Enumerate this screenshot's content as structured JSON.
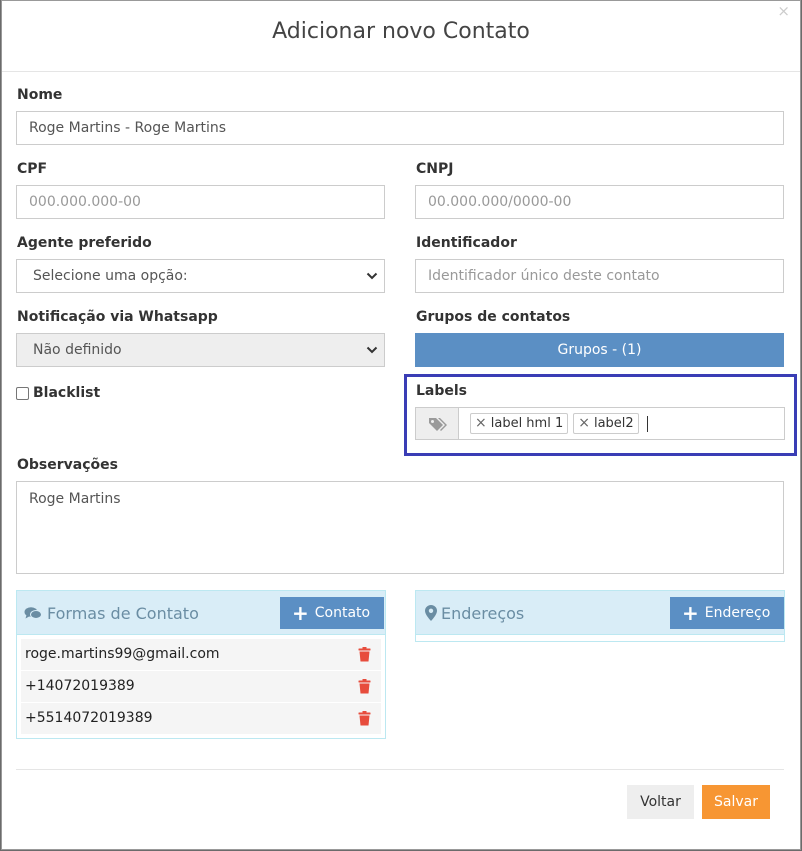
{
  "modal": {
    "title": "Adicionar novo Contato",
    "close_glyph": "×"
  },
  "fields": {
    "nome": {
      "label": "Nome",
      "value": "Roge Martins - Roge Martins"
    },
    "cpf": {
      "label": "CPF",
      "placeholder": "000.000.000-00"
    },
    "cnpj": {
      "label": "CNPJ",
      "placeholder": "00.000.000/0000-00"
    },
    "agente": {
      "label": "Agente preferido",
      "selected": "Selecione uma opção:"
    },
    "identificador": {
      "label": "Identificador",
      "placeholder": "Identificador único deste contato"
    },
    "notificacao": {
      "label": "Notificação via Whatsapp",
      "selected": "Não definido"
    },
    "grupos": {
      "label": "Grupos de contatos",
      "button_label": "Grupos  - (1)"
    },
    "blacklist": {
      "label": "Blacklist",
      "checked": false
    },
    "labels": {
      "label": "Labels",
      "tags": [
        "label hml 1",
        "label2"
      ],
      "tag_remove_glyph": "×"
    },
    "observacoes": {
      "label": "Observações",
      "value": "Roge Martins"
    }
  },
  "formas_contato": {
    "title": "Formas de Contato",
    "add_button": "Contato",
    "items": [
      "roge.martins99@gmail.com",
      "+14072019389",
      "+5514072019389"
    ]
  },
  "enderecos": {
    "title": "Endereços",
    "add_button": "Endereço"
  },
  "footer": {
    "back_label": "Voltar",
    "save_label": "Salvar"
  },
  "colors": {
    "primary_button": "#5b8fc4",
    "save_button": "#f79633",
    "panel_header": "#d9edf7",
    "delete_icon": "#e74c3c",
    "highlight_border": "#3a3db5"
  }
}
